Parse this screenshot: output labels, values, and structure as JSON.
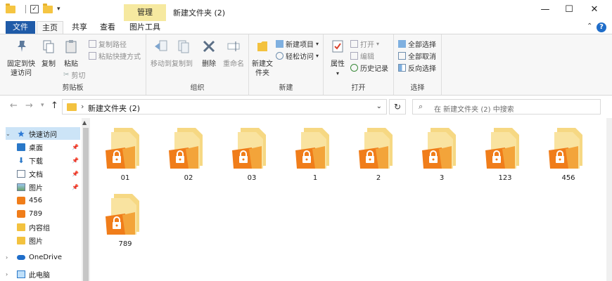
{
  "window": {
    "title": "新建文件夹 (2)",
    "context_tab": "管理",
    "controls": {
      "minimize": "—",
      "maximize": "☐",
      "close": "✕"
    }
  },
  "tabs": [
    {
      "label": "文件"
    },
    {
      "label": "主页"
    },
    {
      "label": "共享"
    },
    {
      "label": "查看"
    },
    {
      "label": "图片工具"
    }
  ],
  "ribbon": {
    "clipboard": {
      "label": "剪贴板",
      "pin": "固定到快速访问",
      "copy": "复制",
      "paste": "粘贴",
      "copy_path": "复制路径",
      "paste_shortcut": "粘贴快捷方式",
      "cut": "剪切"
    },
    "organize": {
      "label": "组织",
      "move_to": "移动到",
      "copy_to": "复制到",
      "delete": "删除",
      "rename": "重命名"
    },
    "new": {
      "label": "新建",
      "new_folder": "新建文件夹",
      "new_item": "新建项目",
      "easy_access": "轻松访问"
    },
    "open": {
      "label": "打开",
      "properties": "属性",
      "open": "打开",
      "edit": "编辑",
      "history": "历史记录"
    },
    "select": {
      "label": "选择",
      "select_all": "全部选择",
      "select_none": "全部取消",
      "invert": "反向选择"
    }
  },
  "address": {
    "path": "新建文件夹 (2)",
    "search_placeholder": "在 新建文件夹 (2) 中搜索"
  },
  "nav": [
    {
      "label": "快速访问",
      "icon": "star-icon",
      "selected": true,
      "pinned": false
    },
    {
      "label": "桌面",
      "icon": "desktop-icon",
      "selected": false,
      "pinned": true
    },
    {
      "label": "下载",
      "icon": "download-icon",
      "selected": false,
      "pinned": true
    },
    {
      "label": "文档",
      "icon": "document-icon",
      "selected": false,
      "pinned": true
    },
    {
      "label": "图片",
      "icon": "pictures-icon",
      "selected": false,
      "pinned": true
    },
    {
      "label": "456",
      "icon": "locked-folder-icon",
      "selected": false,
      "pinned": false
    },
    {
      "label": "789",
      "icon": "locked-folder-icon",
      "selected": false,
      "pinned": false
    },
    {
      "label": "内容组",
      "icon": "folder-icon",
      "selected": false,
      "pinned": false
    },
    {
      "label": "图片",
      "icon": "folder-icon",
      "selected": false,
      "pinned": false
    },
    {
      "label": "OneDrive",
      "icon": "cloud-icon",
      "selected": false,
      "pinned": false
    },
    {
      "label": "此电脑",
      "icon": "computer-icon",
      "selected": false,
      "pinned": false
    }
  ],
  "files": [
    {
      "name": "01"
    },
    {
      "name": "02"
    },
    {
      "name": "03"
    },
    {
      "name": "1"
    },
    {
      "name": "2"
    },
    {
      "name": "3"
    },
    {
      "name": "123"
    },
    {
      "name": "456"
    },
    {
      "name": "789"
    }
  ],
  "colors": {
    "file_tab": "#1f5ba8",
    "manage_tab": "#f6e9a0",
    "folder_yellow": "#f5d06a",
    "lock_orange": "#f07d1a",
    "selection": "#cce4f7"
  }
}
